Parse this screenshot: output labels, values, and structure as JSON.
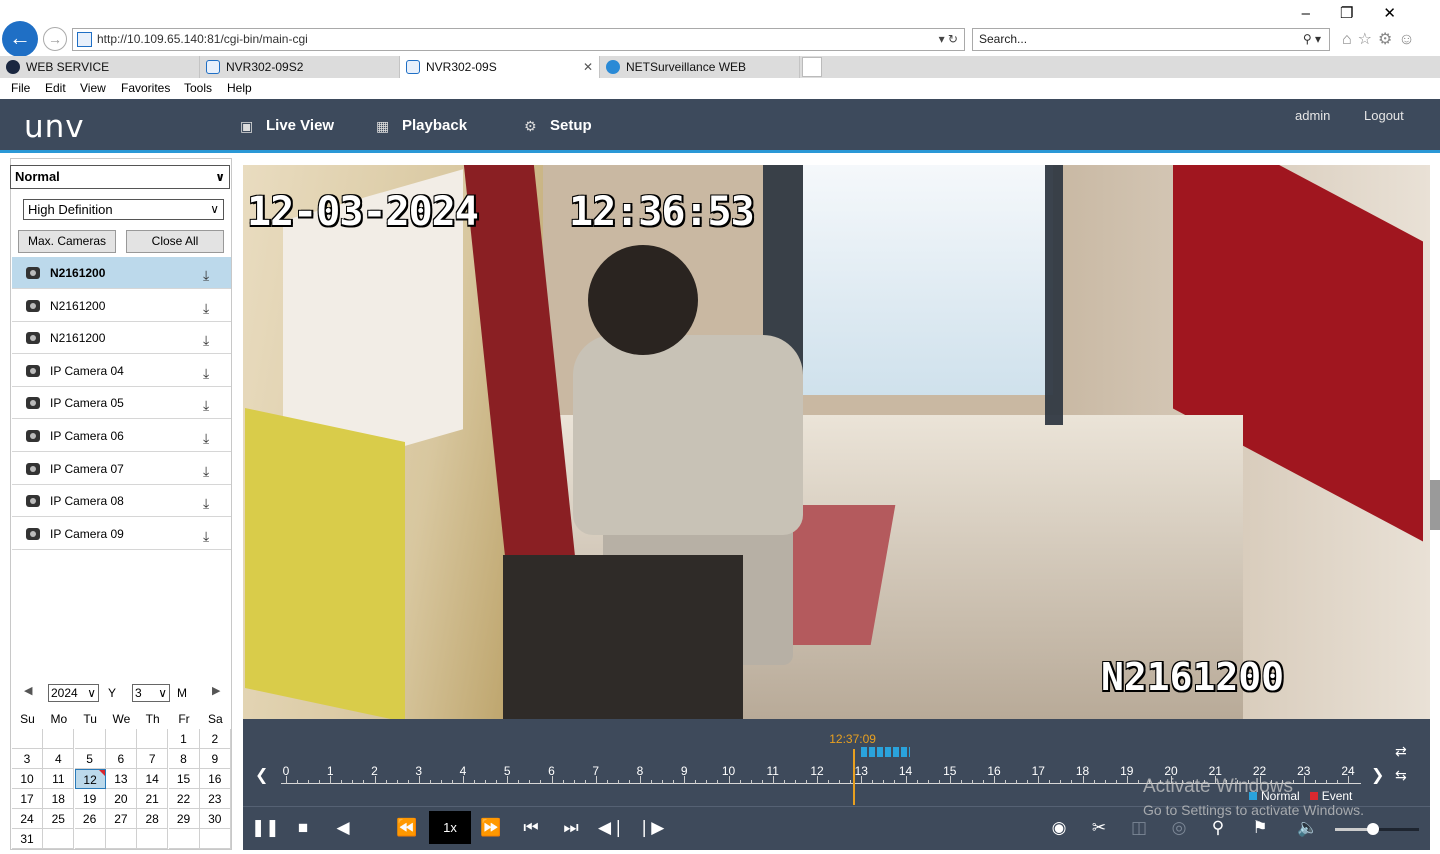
{
  "browser": {
    "url": "http://10.109.65.140:81/cgi-bin/main-cgi",
    "search_placeholder": "Search...",
    "tabs": [
      {
        "label": "WEB SERVICE",
        "active": false,
        "icon_color": "#1a2740"
      },
      {
        "label": "NVR302-09S2",
        "active": false,
        "icon_color": "#1f6fc5"
      },
      {
        "label": "NVR302-09S",
        "active": true,
        "icon_color": "#1f6fc5"
      },
      {
        "label": "NETSurveillance WEB",
        "active": false,
        "icon_color": "#2a8ad6"
      }
    ],
    "menu": [
      "File",
      "Edit",
      "View",
      "Favorites",
      "Tools",
      "Help"
    ]
  },
  "app": {
    "logo": "UNV",
    "nav": [
      {
        "label": "Live View",
        "icon": "monitor-icon",
        "active": false
      },
      {
        "label": "Playback",
        "icon": "calendar-icon",
        "active": true
      },
      {
        "label": "Setup",
        "icon": "gear-icon",
        "active": false
      }
    ],
    "user": "admin",
    "logout": "Logout",
    "accent_color": "#2a98d6",
    "header_color": "#3d4a5c"
  },
  "left_panel": {
    "mode": "Normal",
    "quality": "High Definition",
    "max_cameras": "Max. Cameras",
    "close_all": "Close All",
    "cameras": [
      {
        "label": "N2161200",
        "selected": true
      },
      {
        "label": "N2161200",
        "selected": false
      },
      {
        "label": "N2161200",
        "selected": false
      },
      {
        "label": "IP Camera 04",
        "selected": false
      },
      {
        "label": "IP Camera 05",
        "selected": false
      },
      {
        "label": "IP Camera 06",
        "selected": false
      },
      {
        "label": "IP Camera 07",
        "selected": false
      },
      {
        "label": "IP Camera 08",
        "selected": false
      },
      {
        "label": "IP Camera 09",
        "selected": false
      }
    ]
  },
  "calendar": {
    "year": "2024",
    "year_label": "Y",
    "month": "3",
    "month_label": "M",
    "weekdays": [
      "Su",
      "Mo",
      "Tu",
      "We",
      "Th",
      "Fr",
      "Sa"
    ],
    "first_weekday": 5,
    "days_in_month": 31,
    "selected_day": 12,
    "recorded_days": [
      12
    ]
  },
  "video": {
    "osd_date": "12-03-2024",
    "osd_time": "12:36:53",
    "osd_camera": "N2161200"
  },
  "timeline": {
    "hours": [
      "0",
      "1",
      "2",
      "3",
      "4",
      "5",
      "6",
      "7",
      "8",
      "9",
      "10",
      "11",
      "12",
      "13",
      "14",
      "15",
      "16",
      "17",
      "18",
      "19",
      "20",
      "21",
      "22",
      "23",
      "24"
    ],
    "cursor_time": "12:37:09",
    "cursor_hour": 12.62,
    "recording_from_hour": 12.0,
    "recording_to_hour": 14.1,
    "legend_normal": "Normal",
    "legend_event": "Event",
    "normal_color": "#2aa3dc",
    "event_color": "#d9282f"
  },
  "controls": {
    "speed": "1x",
    "volume": 0.45
  },
  "watermark": {
    "line1": "Activate Windows",
    "line2": "Go to Settings to activate Windows."
  }
}
